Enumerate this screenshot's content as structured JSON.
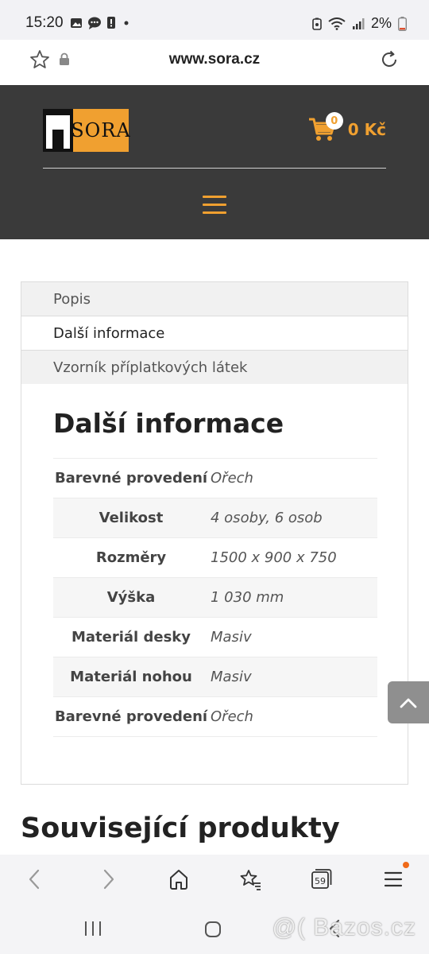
{
  "status_bar": {
    "time": "15:20",
    "battery": "2%",
    "icons": [
      "gallery-icon",
      "chat-icon",
      "alert-icon",
      "dot-icon",
      "battery-saver-icon",
      "wifi-icon",
      "signal-icon",
      "battery-icon"
    ]
  },
  "browser": {
    "url": "www.sora.cz",
    "tab_count": "59"
  },
  "header": {
    "logo_text": "SORA",
    "cart_count": "0",
    "cart_total": "0 Kč",
    "accent_color": "#f0a030",
    "background_color": "#3a3a3a"
  },
  "tabs": [
    {
      "label": "Popis",
      "active": false
    },
    {
      "label": "Další informace",
      "active": true
    },
    {
      "label": "Vzorník příplatkových látek",
      "active": false
    }
  ],
  "panel": {
    "title": "Další informace",
    "rows": [
      {
        "label": "Barevné provedení",
        "value": "Ořech"
      },
      {
        "label": "Velikost",
        "value": "4 osoby, 6 osob"
      },
      {
        "label": "Rozměry",
        "value": "1500 x 900 x 750"
      },
      {
        "label": "Výška",
        "value": "1 030 mm"
      },
      {
        "label": "Materiál desky",
        "value": "Masiv"
      },
      {
        "label": "Materiál nohou",
        "value": "Masiv"
      },
      {
        "label": "Barevné provedení",
        "value": "Ořech"
      }
    ]
  },
  "related": {
    "heading": "Související produkty"
  },
  "watermark": "@( Bazos.cz"
}
